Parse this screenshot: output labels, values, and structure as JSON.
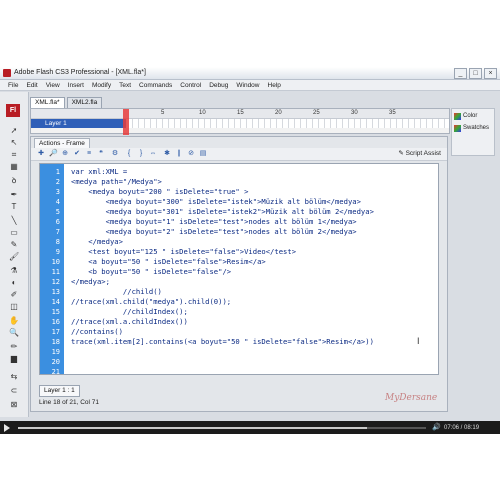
{
  "window": {
    "title": "Adobe Flash CS3 Professional - [XML.fla*]",
    "controls": [
      "_",
      "□",
      "×"
    ]
  },
  "menu": [
    "File",
    "Edit",
    "View",
    "Insert",
    "Modify",
    "Text",
    "Commands",
    "Control",
    "Debug",
    "Window",
    "Help"
  ],
  "tools": {
    "logo": "Fl"
  },
  "doc_tabs": [
    "XML.fla*",
    "XML2.fla"
  ],
  "timeline": {
    "layer": "Layer 1",
    "frame_numbers": [
      "5",
      "10",
      "15",
      "20",
      "25",
      "30",
      "35"
    ]
  },
  "right_panel": {
    "color_label": "Color",
    "swatches_label": "Swatches"
  },
  "actions_panel": {
    "tab": "Actions - Frame",
    "script_assist": "Script Assist",
    "layer_tab": "Layer 1 : 1",
    "status": "Line 18 of 21, Col 71"
  },
  "code_lines": [
    {
      "n": "1",
      "text": "var xml:XML ="
    },
    {
      "n": "2",
      "text": "<medya path=\"/Medya\">"
    },
    {
      "n": "3",
      "text": "    <medya boyut=\"200 \" isDelete=\"true\" >"
    },
    {
      "n": "4",
      "text": "        <medya boyut=\"300\" isDelete=\"istek\">Müzik alt bölüm</medya>"
    },
    {
      "n": "5",
      "text": "        <medya boyut=\"301\" isDelete=\"istek2\">Müzik alt bölüm 2</medya>"
    },
    {
      "n": "6",
      "text": "        <medya boyut=\"1\" isDelete=\"test\">nodes alt bölüm 1</medya>"
    },
    {
      "n": "7",
      "text": "        <medya boyut=\"2\" isDelete=\"test\">nodes alt bölüm 2</medya>"
    },
    {
      "n": "8",
      "text": "    </medya>"
    },
    {
      "n": "9",
      "text": "    <test boyut=\"125 \" isDelete=\"false\">Video</test>"
    },
    {
      "n": "10",
      "text": "    <a boyut=\"50 \" isDelete=\"false\">Resim</a>"
    },
    {
      "n": "11",
      "text": "    <b boyut=\"50 \" isDelete=\"false\"/>"
    },
    {
      "n": "12",
      "text": "</medya>;"
    },
    {
      "n": "13",
      "text": "            //child()"
    },
    {
      "n": "14",
      "text": "//trace(xml.child(\"medya\").child(0));"
    },
    {
      "n": "15",
      "text": "            //childIndex();"
    },
    {
      "n": "16",
      "text": "//trace(xml.a.childIndex())"
    },
    {
      "n": "17",
      "text": "//contains()"
    },
    {
      "n": "18",
      "text": "trace(xml.item[2].contains(<a boyut=\"50 \" isDelete=\"false\">Resim</a>))"
    },
    {
      "n": "19",
      "text": ""
    },
    {
      "n": "20",
      "text": ""
    },
    {
      "n": "21",
      "text": ""
    }
  ],
  "watermark": "MyDersane",
  "player": {
    "time": "07:06 / 08:19",
    "progress": 0.855
  }
}
